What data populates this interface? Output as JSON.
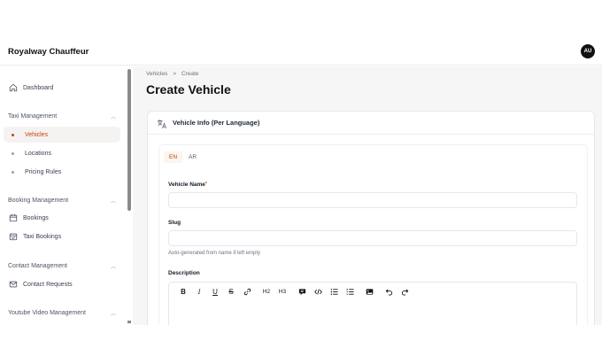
{
  "app": {
    "brand": "Royalway Chauffeur",
    "avatar_initials": "AU"
  },
  "sidebar": {
    "dashboard": "Dashboard",
    "groups": [
      {
        "label": "Taxi Management",
        "items": [
          "Vehicles",
          "Locations",
          "Pricing Rules"
        ]
      },
      {
        "label": "Booking Management",
        "items": [
          "Bookings",
          "Taxi Bookings"
        ]
      },
      {
        "label": "Contact Management",
        "items": [
          "Contact Requests"
        ]
      },
      {
        "label": "Youtube Video Management",
        "items": []
      }
    ],
    "active_item": "Vehicles"
  },
  "breadcrumb": {
    "parent": "Vehicles",
    "separator": ">",
    "current": "Create"
  },
  "page": {
    "title": "Create Vehicle"
  },
  "card": {
    "title": "Vehicle Info (Per Language)"
  },
  "lang_tabs": [
    {
      "label": "EN",
      "active": true
    },
    {
      "label": "AR",
      "active": false
    }
  ],
  "form": {
    "vehicle_name": {
      "label": "Vehicle Name",
      "required_mark": "*",
      "value": "",
      "placeholder": ""
    },
    "slug": {
      "label": "Slug",
      "value": "",
      "placeholder": "",
      "hint": "Auto-generated from name if left empty"
    },
    "description": {
      "label": "Description",
      "value": ""
    }
  },
  "editor_toolbar": [
    "B",
    "I",
    "U",
    "S",
    "link-icon",
    "H2",
    "H3",
    "comment-icon",
    "code-icon",
    "bullet-list-icon",
    "ordered-list-icon",
    "image-icon",
    "undo-icon",
    "redo-icon"
  ],
  "colors": {
    "accent": "#c2410c",
    "active_bg": "#f5f3f1",
    "content_bg": "#f6f6f6"
  }
}
